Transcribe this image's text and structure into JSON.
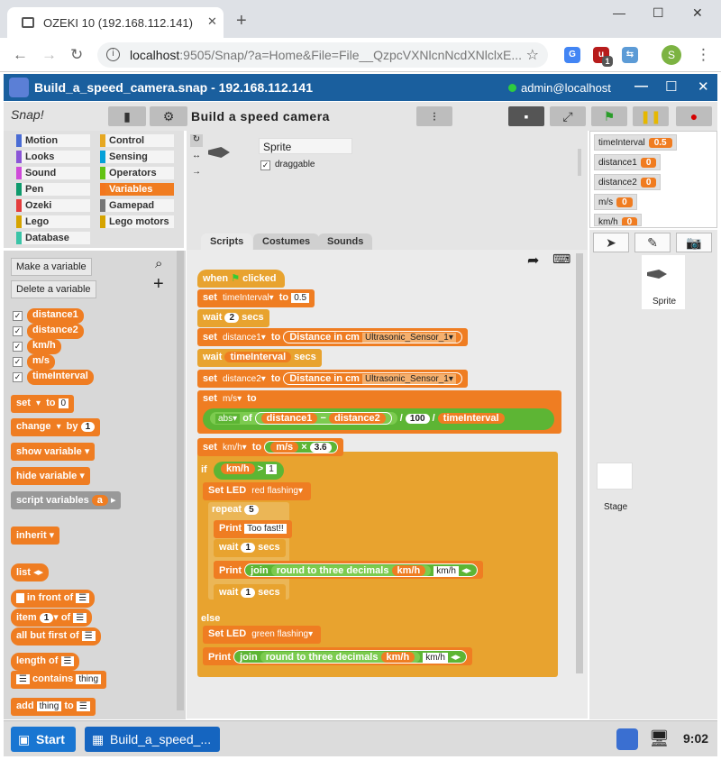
{
  "browser": {
    "tab_title": "OZEKI 10 (192.168.112.141)",
    "url_host": "localhost",
    "url_rest": ":9505/Snap/?a=Home&File=File__QzpcVXNlcnNcdXNlclxE...",
    "profile_initial": "S",
    "ext_badge": "1"
  },
  "app": {
    "title": "Build_a_speed_camera.snap - 192.168.112.141",
    "user": "admin@localhost"
  },
  "snap": {
    "logo": "Snap!",
    "project_title": "Build a speed camera",
    "categories": [
      "Motion",
      "Looks",
      "Sound",
      "Pen",
      "Ozeki",
      "Lego",
      "Database",
      "Control",
      "Sensing",
      "Operators",
      "Variables",
      "Gamepad",
      "Lego motors"
    ],
    "category_colors": [
      "#4a6cd4",
      "#8a55d7",
      "#cf4ad9",
      "#0e9a6c",
      "#e43d3d",
      "#d6a400",
      "#3ac4a7",
      "#e6a822",
      "#04a0d8",
      "#62c213",
      "#f3761d",
      "#777777",
      "#d6a400"
    ],
    "make_variable": "Make a variable",
    "delete_variable": "Delete a variable",
    "variables": [
      "distance1",
      "distance2",
      "km/h",
      "m/s",
      "timeInterval"
    ],
    "sprite_name": "Sprite",
    "draggable": "draggable",
    "tabs": [
      "Scripts",
      "Costumes",
      "Sounds"
    ],
    "stage_label": "Stage",
    "corral_sprite": "Sprite"
  },
  "palette_blocks": {
    "set": "set",
    "to": "to",
    "set_val": "0",
    "change": "change",
    "by": "by",
    "change_val": "1",
    "show_var": "show variable",
    "hide_var": "hide variable",
    "script_vars": "script variables",
    "script_vars_a": "a",
    "inherit": "inherit",
    "list": "list",
    "in_front_of": "in front of",
    "item": "item",
    "item_val": "1",
    "of": "of",
    "all_but_first": "all but first of",
    "length_of": "length of",
    "contains": "contains",
    "thing": "thing",
    "add": "add",
    "add_thing": "thing",
    "add_to": "to"
  },
  "script": {
    "when": "when",
    "clicked": "clicked",
    "set": "set",
    "to": "to",
    "var_timeInterval": "timeInterval",
    "val_05": "0.5",
    "wait": "wait",
    "secs": "secs",
    "val_2": "2",
    "var_distance1": "distance1",
    "distance_in_cm": "Distance in cm",
    "sensor": "Ultrasonic_Sensor_1",
    "var_distance2": "distance2",
    "var_ms": "m/s",
    "abs": "abs",
    "of": "of",
    "minus": "−",
    "div": "/",
    "val_100": "100",
    "var_kmh": "km/h",
    "times": "×",
    "val_36": "3.6",
    "if": "if",
    "gt": ">",
    "val_1": "1",
    "set_led": "Set LED",
    "red_flashing": "red flashing",
    "repeat": "repeat",
    "val_5": "5",
    "print": "Print",
    "too_fast": "Too fast!!",
    "val_1b": "1",
    "join": "join",
    "round3": "round to three decimals",
    "kmh_text": "km/h",
    "else": "else",
    "green_flashing": "green flashing"
  },
  "watchers": [
    {
      "name": "timeInterval",
      "value": "0.5"
    },
    {
      "name": "distance1",
      "value": "0"
    },
    {
      "name": "distance2",
      "value": "0"
    },
    {
      "name": "m/s",
      "value": "0"
    },
    {
      "name": "km/h",
      "value": "0"
    }
  ],
  "taskbar": {
    "start": "Start",
    "app": "Build_a_speed_...",
    "clock": "9:02"
  }
}
